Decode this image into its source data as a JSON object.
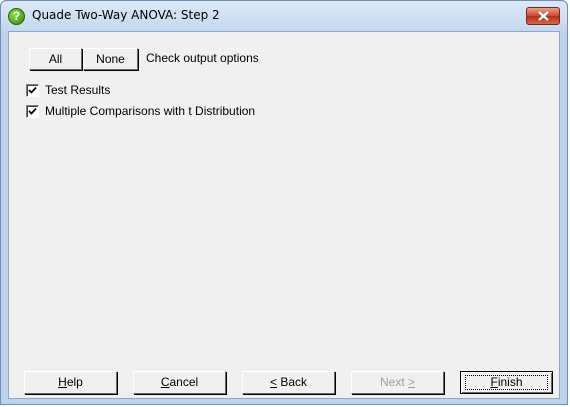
{
  "window": {
    "title": "Quade Two-Way ANOVA: Step 2"
  },
  "toolbar": {
    "all_label": "All",
    "none_label": "None",
    "instruction": "Check output options"
  },
  "options": [
    {
      "label": "Test Results",
      "checked": true
    },
    {
      "label": "Multiple Comparisons with t Distribution",
      "checked": true
    }
  ],
  "buttons": {
    "help": {
      "accel": "H",
      "rest": "elp"
    },
    "cancel": {
      "accel": "C",
      "rest": "ancel"
    },
    "back": {
      "accel": "<",
      "rest": " Back"
    },
    "next": {
      "pre": "Next ",
      "accel": ">"
    },
    "finish": {
      "accel": "F",
      "rest": "inish"
    }
  }
}
